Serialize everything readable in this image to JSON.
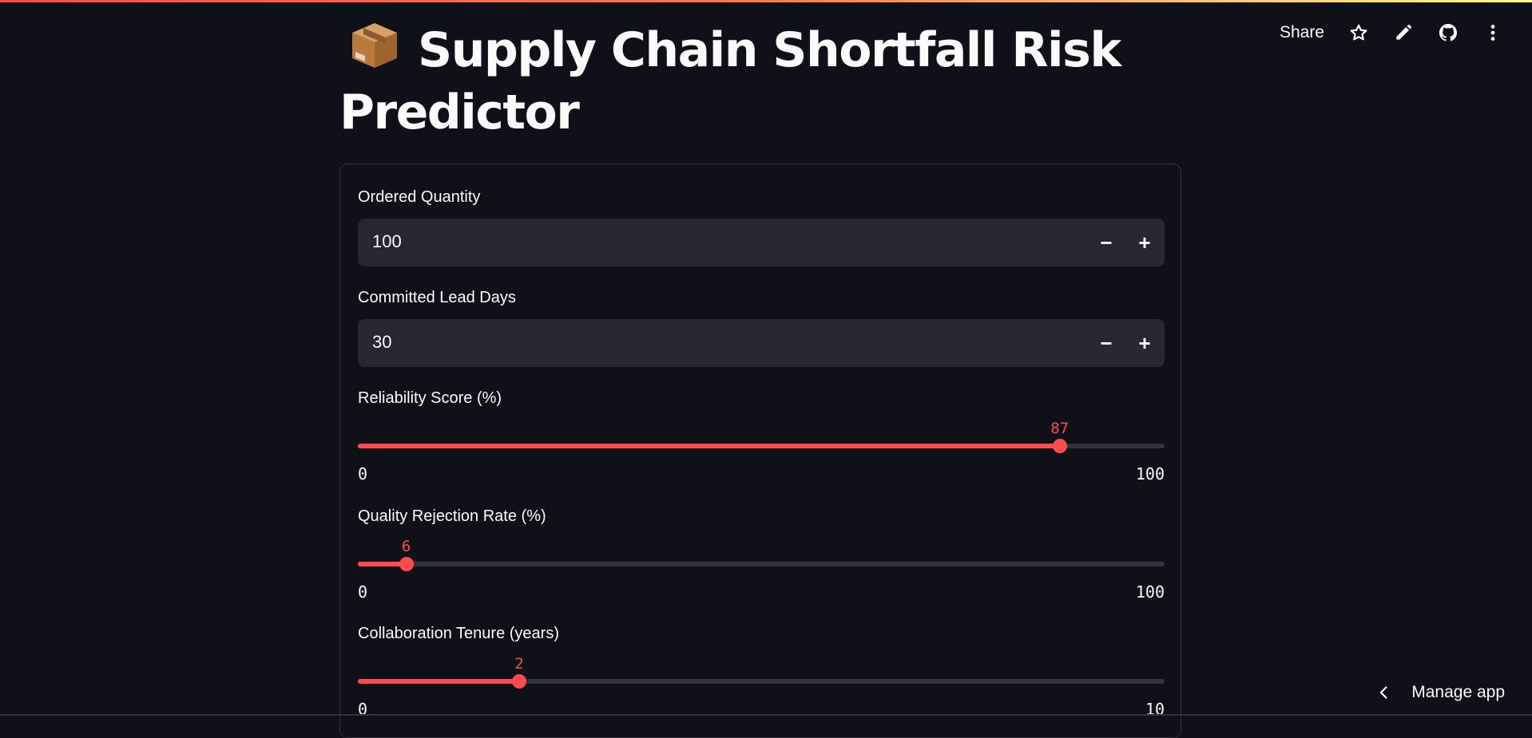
{
  "header": {
    "share_label": "Share",
    "icons": [
      "star-icon",
      "pencil-icon",
      "github-icon",
      "more-vertical-icon"
    ]
  },
  "title": {
    "emoji": "package-box-emoji",
    "text": "Supply Chain Shortfall Risk Predictor"
  },
  "form": {
    "ordered_quantity": {
      "label": "Ordered Quantity",
      "value": "100"
    },
    "committed_lead_days": {
      "label": "Committed Lead Days",
      "value": "30"
    },
    "reliability_score": {
      "label": "Reliability Score (%)",
      "value": 87,
      "min": 0,
      "max": 100,
      "value_text": "87",
      "min_text": "0",
      "max_text": "100"
    },
    "quality_rejection_rate": {
      "label": "Quality Rejection Rate (%)",
      "value": 6,
      "min": 0,
      "max": 100,
      "value_text": "6",
      "min_text": "0",
      "max_text": "100"
    },
    "collaboration_tenure": {
      "label": "Collaboration Tenure (years)",
      "value": 2,
      "min": 0,
      "max": 10,
      "value_text": "2",
      "min_text": "0",
      "max_text": "10"
    }
  },
  "footer": {
    "manage_app_label": "Manage app"
  },
  "colors": {
    "background": "#0e1117",
    "accent": "#ff4b4b",
    "input_bg": "#262730",
    "border": "#31333f"
  }
}
